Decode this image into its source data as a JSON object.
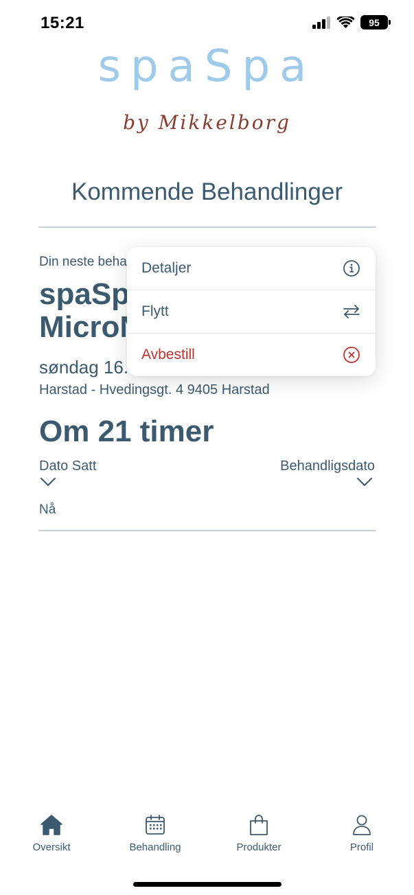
{
  "status_bar": {
    "time": "15:21",
    "battery": "95",
    "icons": [
      "cellular-signal-icon",
      "wifi-icon",
      "battery-icon"
    ]
  },
  "logo": {
    "main": "spaSpa",
    "sub": "by Mikkelborg"
  },
  "page_title": "Kommende Behandlinger",
  "next_treatment": {
    "label": "Din neste beha",
    "name_line1": "spaSp",
    "name_line2": "MicroN",
    "date": "søndag 16.",
    "location": "Harstad - Hvedingsgt. 4 9405 Harstad",
    "countdown": "Om 21 timer"
  },
  "timeline": {
    "left_label": "Dato Satt",
    "right_label": "Behandligsdato",
    "now_label": "Nå"
  },
  "context_menu": {
    "items": [
      {
        "label": "Detaljer",
        "icon": "info-icon"
      },
      {
        "label": "Flytt",
        "icon": "swap-arrows-icon"
      },
      {
        "label": "Avbestill",
        "icon": "cancel-circle-icon"
      }
    ]
  },
  "tab_bar": {
    "tabs": [
      {
        "label": "Oversikt",
        "icon": "home-icon"
      },
      {
        "label": "Behandling",
        "icon": "calendar-icon"
      },
      {
        "label": "Produkter",
        "icon": "shopping-bag-icon"
      },
      {
        "label": "Profil",
        "icon": "person-icon"
      }
    ]
  },
  "colors": {
    "primary_text": "#3b5a70",
    "logo_blue": "#9fcbea",
    "logo_sub": "#8a3d2e",
    "destructive": "#c2322c"
  }
}
